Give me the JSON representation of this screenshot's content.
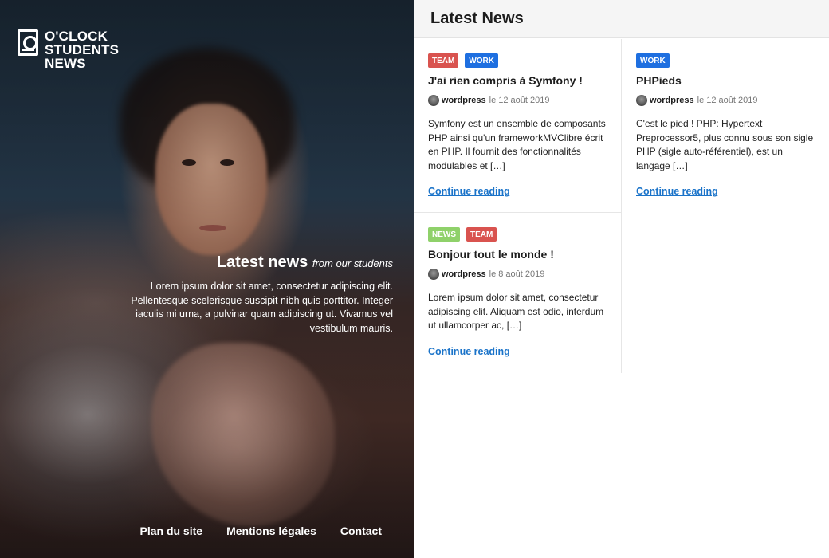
{
  "brand": {
    "line1": "O'CLOCK",
    "line2": "STUDENTS",
    "line3": "NEWS"
  },
  "hero": {
    "title": "Latest news",
    "subtitle": "from our students",
    "text": "Lorem ipsum dolor sit amet, consectetur adipiscing elit. Pellentesque scelerisque suscipit nibh quis porttitor. Integer iaculis mi urna, a pulvinar quam adipiscing ut. Vivamus vel vestibulum mauris."
  },
  "footer": {
    "links": [
      "Plan du site",
      "Mentions légales",
      "Contact"
    ]
  },
  "main": {
    "heading": "Latest News",
    "posts": [
      {
        "tags": [
          {
            "label": "TEAM",
            "color": "#d9534f"
          },
          {
            "label": "WORK",
            "color": "#1e6fe0"
          }
        ],
        "title": "J'ai rien compris à Symfony !",
        "author": "wordpress",
        "date": "le 12 août 2019",
        "excerpt": "Symfony est un ensemble de composants PHP ainsi qu'un frameworkMVClibre écrit en PHP. Il fournit des fonctionnalités modulables et […]",
        "more": "Continue reading"
      },
      {
        "tags": [
          {
            "label": "WORK",
            "color": "#1e6fe0"
          }
        ],
        "title": "PHPieds",
        "author": "wordpress",
        "date": "le 12 août 2019",
        "excerpt": "C'est le pied ! PHP: Hypertext Preprocessor5, plus connu sous son sigle PHP (sigle auto-référentiel), est un langage […]",
        "more": "Continue reading"
      },
      {
        "tags": [
          {
            "label": "NEWS",
            "color": "#8fd16a"
          },
          {
            "label": "TEAM",
            "color": "#d9534f"
          }
        ],
        "title": "Bonjour tout le monde !",
        "author": "wordpress",
        "date": "le 8 août 2019",
        "excerpt": "Lorem ipsum dolor sit amet, consectetur adipiscing elit. Aliquam est odio, interdum ut ullamcorper ac, […]",
        "more": "Continue reading"
      }
    ]
  }
}
